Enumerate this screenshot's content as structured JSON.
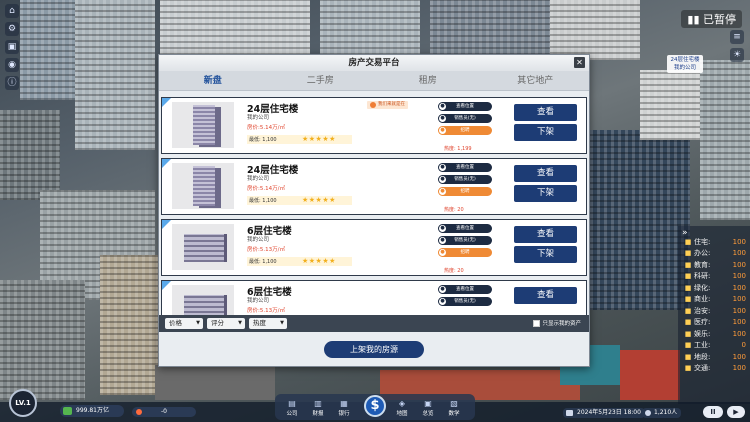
{
  "hud": {
    "paused": "已暂停",
    "building_tag": {
      "name": "24层住宅楼",
      "owner": "我的公司"
    },
    "level": "LV.1",
    "money": "999.81万亿",
    "income": "-0",
    "date": "2024年5月23日 18:00",
    "population": "1,210人",
    "pause_button": "II"
  },
  "stats": {
    "arrow": "»",
    "items": [
      {
        "label": "住宅:",
        "value": "100"
      },
      {
        "label": "办公:",
        "value": "100"
      },
      {
        "label": "教育:",
        "value": "100"
      },
      {
        "label": "科研:",
        "value": "100"
      },
      {
        "label": "绿化:",
        "value": "100"
      },
      {
        "label": "商业:",
        "value": "100"
      },
      {
        "label": "治安:",
        "value": "100"
      },
      {
        "label": "医疗:",
        "value": "100"
      },
      {
        "label": "娱乐:",
        "value": "100"
      },
      {
        "label": "工业:",
        "value": "0"
      },
      {
        "label": "地段:",
        "value": "100"
      },
      {
        "label": "交通:",
        "value": "100"
      }
    ]
  },
  "dock": {
    "items": [
      {
        "label": "公司",
        "icon": "company-icon"
      },
      {
        "label": "财报",
        "icon": "report-icon"
      },
      {
        "label": "银行",
        "icon": "bank-icon"
      },
      {
        "label": "地图",
        "icon": "map-icon"
      },
      {
        "label": "总览",
        "icon": "overview-icon"
      },
      {
        "label": "数学",
        "icon": "math-icon"
      }
    ],
    "center": "$"
  },
  "modal": {
    "title": "房产交易平台",
    "close": "✕",
    "tabs": [
      "新盘",
      "二手房",
      "租房",
      "其它地产"
    ],
    "filters": [
      "价格",
      "评分",
      "热度"
    ],
    "only_mine": "只显示我的资产",
    "list_button": "上架我的房源",
    "listings": [
      {
        "title": "24层住宅楼",
        "company": "我的公司",
        "price": "房价:5.14万/㎡",
        "min": "最低: 1,100",
        "badge": "我们来就是在",
        "heat": "热度: 1,199",
        "stars": "★★★★★"
      },
      {
        "title": "24层住宅楼",
        "company": "我的公司",
        "price": "房价:5.14万/㎡",
        "min": "最低: 1,100",
        "badge": "",
        "heat": "热度: 20",
        "stars": "★★★★★"
      },
      {
        "title": "6层住宅楼",
        "company": "我的公司",
        "price": "房价:5.13万/㎡",
        "min": "最低: 1,100",
        "badge": "",
        "heat": "热度: 20",
        "stars": "★★★★★"
      },
      {
        "title": "6层住宅楼",
        "company": "我的公司",
        "price": "房价:5.13万/㎡",
        "min": "",
        "badge": "",
        "heat": "",
        "stars": ""
      }
    ],
    "actions": {
      "locate": "查看位置",
      "sales": "销售员(无)",
      "hire": "招聘",
      "view": "查看",
      "delist": "下架"
    }
  }
}
